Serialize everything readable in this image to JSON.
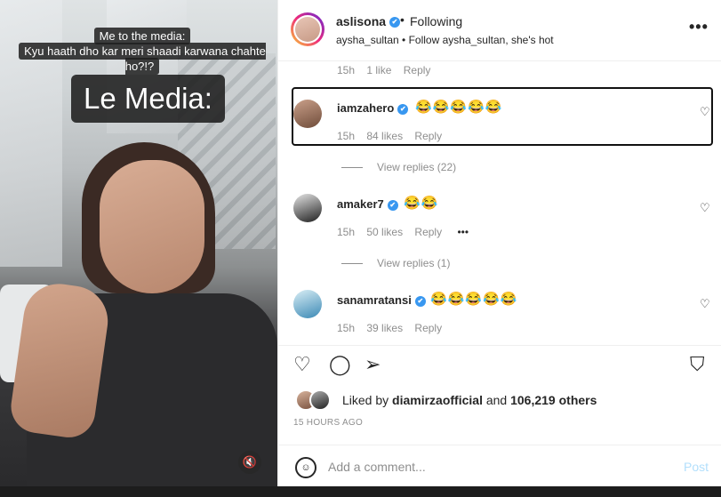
{
  "media": {
    "caption_line1": "Me to the media:",
    "caption_line2": "Kyu haath dho kar meri shaadi karwana chahte ho?!?",
    "caption_big": "Le Media:",
    "mute_icon": "🔇"
  },
  "header": {
    "username": "aslisona",
    "verified_glyph": "✔",
    "dot": "•",
    "follow_label": "Following",
    "subtitle": "aysha_sultan • Follow aysha_sultan, she's hot",
    "more_glyph": "•••"
  },
  "caption_meta": {
    "time": "15h",
    "likes": "1 like",
    "reply": "Reply"
  },
  "comments": [
    {
      "user": "iamzahero",
      "emojis": "😂😂😂😂😂",
      "time": "15h",
      "likes": "84 likes",
      "reply": "Reply",
      "view_replies": "View replies (22)"
    },
    {
      "user": "amaker7",
      "emojis": "😂😂",
      "time": "15h",
      "likes": "50 likes",
      "reply": "Reply",
      "more": "•••",
      "view_replies": "View replies (1)"
    },
    {
      "user": "sanamratansi",
      "emojis": "😂😂😂😂😂",
      "time": "15h",
      "likes": "39 likes",
      "reply": "Reply"
    }
  ],
  "icons": {
    "heart": "♡",
    "like": "♡",
    "comment": "◯",
    "share": "➢",
    "save": "⛉",
    "smile": "☺"
  },
  "liked_by": {
    "prefix": "Liked by ",
    "user": "diamirzaofficial",
    "middle": " and ",
    "count": "106,219 others"
  },
  "time_ago": "15 HOURS AGO",
  "comment_box": {
    "placeholder": "Add a comment...",
    "post": "Post"
  }
}
